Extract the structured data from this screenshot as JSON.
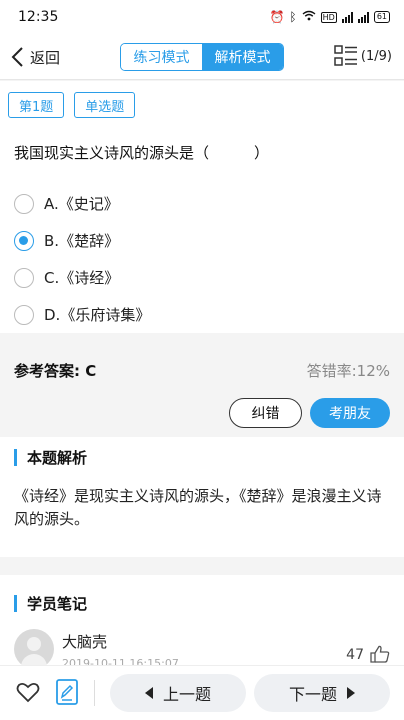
{
  "status_bar": {
    "time": "12:35",
    "battery": "61"
  },
  "nav": {
    "back_label": "返回",
    "modes": [
      "练习模式",
      "解析模式"
    ],
    "active_mode": "解析模式",
    "progress": "(1/9)"
  },
  "question": {
    "number_tag": "第1题",
    "type_tag": "单选题",
    "stem": "我国现实主义诗风的源头是（　　　）",
    "options": [
      {
        "letter": "A.",
        "text": "《史记》",
        "selected": false
      },
      {
        "letter": "B.",
        "text": "《楚辞》",
        "selected": true
      },
      {
        "letter": "C.",
        "text": "《诗经》",
        "selected": false
      },
      {
        "letter": "D.",
        "text": "《乐府诗集》",
        "selected": false
      }
    ]
  },
  "answer": {
    "reference": "参考答案: C",
    "error_rate": "答错率:12%",
    "correct_button": "纠错",
    "ask_button": "考朋友"
  },
  "analysis": {
    "title": "本题解析",
    "text": "《诗经》是现实主义诗风的源头，《楚辞》是浪漫主义诗风的源头。"
  },
  "notes": {
    "title": "学员笔记",
    "user": "大脑壳",
    "time": "2019-10-11 16:15:07",
    "likes": "47"
  },
  "bottom": {
    "prev_label": "上一题",
    "next_label": "下一题"
  },
  "colors": {
    "accent": "#2a9de8"
  }
}
